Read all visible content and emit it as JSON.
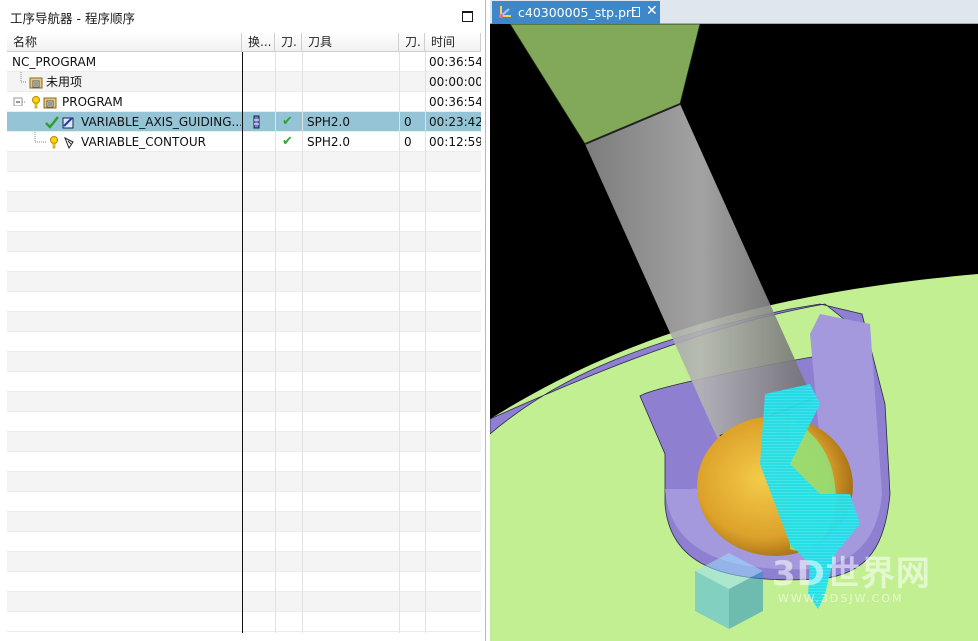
{
  "navigator": {
    "title": "工序导航器 - 程序顺序",
    "columns": [
      "名称",
      "换...",
      "刀.",
      "刀具",
      "刀.",
      "时间"
    ],
    "rows": [
      {
        "name": "NC_PROGRAM",
        "change": "",
        "path": "",
        "tool": "",
        "toolnum": "",
        "time": "00:36:54",
        "icon": "none",
        "status": "",
        "selected": false
      },
      {
        "name": "未用项",
        "change": "",
        "path": "",
        "tool": "",
        "toolnum": "",
        "time": "00:00:00",
        "icon": "group-folder-icon",
        "status": "",
        "selected": false
      },
      {
        "name": "PROGRAM",
        "change": "",
        "path": "",
        "tool": "",
        "toolnum": "",
        "time": "00:36:54",
        "icon": "group-folder-icon",
        "status": "regenerate-icon",
        "selected": false
      },
      {
        "name": "VARIABLE_AXIS_GUIDING...",
        "change": "",
        "path": "✔",
        "tool": "SPH2.0",
        "toolnum": "0",
        "time": "00:23:42",
        "icon": "operation-icon",
        "status": "complete-check-icon",
        "selected": true
      },
      {
        "name": "VARIABLE_CONTOUR",
        "change": "",
        "path": "✔",
        "tool": "SPH2.0",
        "toolnum": "0",
        "time": "00:12:59",
        "icon": "operation-icon",
        "status": "regenerate-icon",
        "selected": false
      }
    ]
  },
  "graphics": {
    "tab_label": "c40300005_stp.prt",
    "watermark_text": "3D世界网",
    "watermark_url": "WWW.3DSJW.COM"
  }
}
